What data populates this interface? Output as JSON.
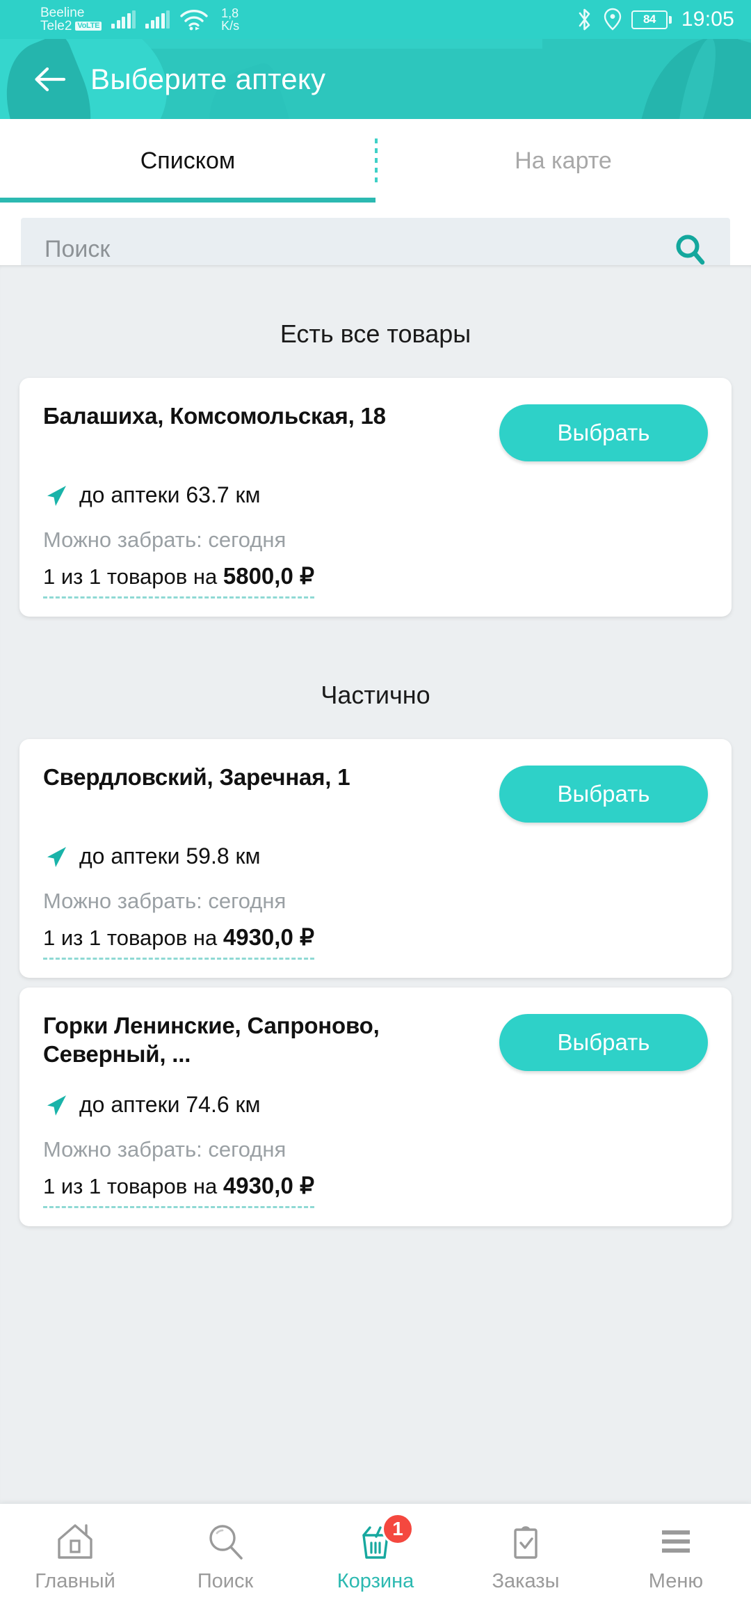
{
  "statusbar": {
    "carrier1": "Beeline",
    "carrier2": "Tele2",
    "volte_badge": "VoLTE",
    "net_speed_value": "1,8",
    "net_speed_unit": "K/s",
    "bluetooth_icon": "bluetooth-icon",
    "location_icon": "location-pin-icon",
    "battery_level": "84",
    "time": "19:05"
  },
  "header": {
    "back_icon": "back-arrow-icon",
    "title": "Выберите аптеку"
  },
  "tabs": [
    {
      "label": "Списком",
      "active": true
    },
    {
      "label": "На карте",
      "active": false
    }
  ],
  "search": {
    "placeholder": "Поиск",
    "icon": "search-icon"
  },
  "sections": [
    {
      "title": "Есть все товары",
      "cards": [
        {
          "address": "Балашиха, Комсомольская, 18",
          "distance": "до аптеки 63.7 км",
          "pickup": "Можно забрать: сегодня",
          "goods_prefix": "1 из 1 товаров на",
          "price": "5800,0 ₽",
          "button": "Выбрать"
        }
      ]
    },
    {
      "title": "Частично",
      "cards": [
        {
          "address": "Свердловский, Заречная, 1",
          "distance": "до аптеки 59.8 км",
          "pickup": "Можно забрать: сегодня",
          "goods_prefix": "1 из 1 товаров на",
          "price": "4930,0 ₽",
          "button": "Выбрать"
        },
        {
          "address": "Горки Ленинские, Сапроново, Северный, ...",
          "distance": "до аптеки 74.6 км",
          "pickup": "Можно забрать: сегодня",
          "goods_prefix": "1 из 1 товаров на",
          "price": "4930,0 ₽",
          "button": "Выбрать"
        }
      ]
    }
  ],
  "bottomnav": [
    {
      "label": "Главный",
      "icon": "home-icon",
      "active": false
    },
    {
      "label": "Поиск",
      "icon": "search-icon",
      "active": false
    },
    {
      "label": "Корзина",
      "icon": "basket-icon",
      "active": true,
      "badge": "1"
    },
    {
      "label": "Заказы",
      "icon": "clipboard-check-icon",
      "active": false
    },
    {
      "label": "Меню",
      "icon": "hamburger-menu-icon",
      "active": false
    }
  ],
  "colors": {
    "brand_teal": "#2ed1c8",
    "header_teal": "#2dc6bd",
    "accent_teal": "#2cb9b1",
    "badge_red": "#f4483f",
    "page_bg": "#eceff1"
  }
}
